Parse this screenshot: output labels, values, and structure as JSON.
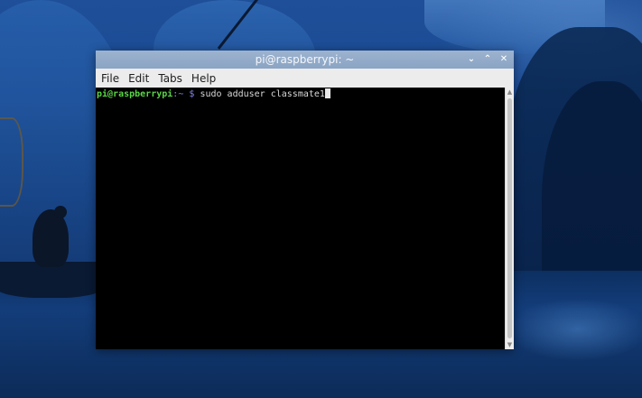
{
  "window": {
    "title": "pi@raspberrypi: ~",
    "controls": {
      "minimize_icon": "chevron-down-icon",
      "maximize_icon": "chevron-up-icon",
      "close_icon": "close-icon",
      "minimize_glyph": "⌄",
      "maximize_glyph": "⌃",
      "close_glyph": "✕"
    }
  },
  "menu": {
    "file": "File",
    "edit": "Edit",
    "tabs": "Tabs",
    "help": "Help"
  },
  "terminal": {
    "prompt_user": "pi@raspberrypi",
    "prompt_separator": ":",
    "prompt_path": "~",
    "prompt_symbol": "$",
    "command": "sudo adduser classmate1",
    "colors": {
      "background": "#000000",
      "user": "#5ad646",
      "path": "#7f86e8",
      "text": "#d9d9d9"
    }
  },
  "titlebar_color": "#8aa4c4"
}
